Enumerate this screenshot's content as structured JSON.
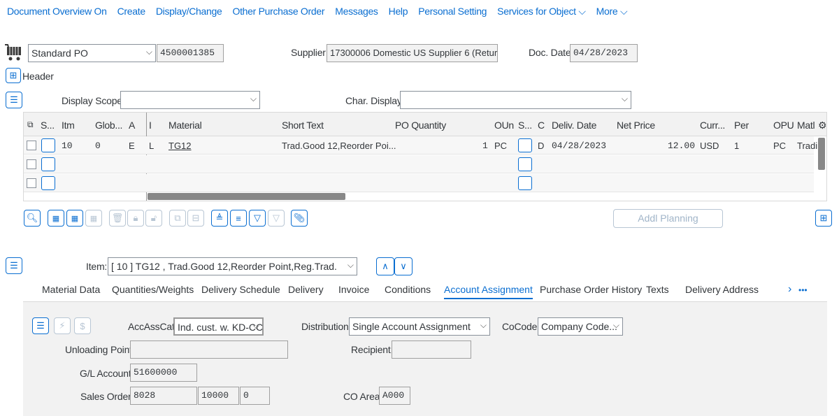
{
  "menu": [
    "Document Overview On",
    "Create",
    "Display/Change",
    "Other Purchase Order",
    "Messages",
    "Help",
    "Personal Setting",
    "Services for Object",
    "More"
  ],
  "doc": {
    "type": "Standard PO",
    "number": "4500001385",
    "supplier_label": "Supplier:",
    "supplier": "17300006 Domestic US Supplier 6 (Retur...",
    "date_label": "Doc. Date:",
    "date": "04/28/2023",
    "header_label": "Header"
  },
  "scope": {
    "display_scope_label": "Display Scope:",
    "display_scope": "",
    "char_display_label": "Char. Display:",
    "char_display": ""
  },
  "grid": {
    "headers": [
      "S...",
      "Itm",
      "Glob...",
      "A",
      "I",
      "Material",
      "Short Text",
      "PO Quantity",
      "OUn",
      "S...",
      "C",
      "Deliv. Date",
      "Net Price",
      "Curr...",
      "Per",
      "OPU",
      "Matl"
    ],
    "rows": [
      {
        "itm": "10",
        "glob": "0",
        "a": "E",
        "i": "L",
        "material": "TG12",
        "short_text": "Trad.Good 12,Reorder Poi...",
        "qty": "1",
        "oun": "PC",
        "c": "D",
        "date": "04/28/2023",
        "price": "12.00",
        "curr": "USD",
        "per": "1",
        "opu": "PC",
        "matl": "Tradii"
      }
    ]
  },
  "toolbar": {
    "addl_planning": "Addl Planning"
  },
  "item": {
    "label": "Item:",
    "value": "[ 10 ] TG12 , Trad.Good 12,Reorder Point,Reg.Trad."
  },
  "tabs": [
    "Material Data",
    "Quantities/Weights",
    "Delivery Schedule",
    "Delivery",
    "Invoice",
    "Conditions",
    "Account Assignment",
    "Purchase Order History",
    "Texts",
    "Delivery Address"
  ],
  "acct": {
    "accasscat_label": "AccAssCat:",
    "accasscat": "Ind. cust. w. KD-CC",
    "distribution_label": "Distribution:",
    "distribution": "Single Account Assignment",
    "cocode_label": "CoCode:",
    "cocode": "Company Code...",
    "unloading_label": "Unloading Point:",
    "unloading": "",
    "recipient_label": "Recipient:",
    "recipient": "",
    "gl_label": "G/L Account:",
    "gl": "51600000",
    "sales_order_label": "Sales Order:",
    "sales_order": "8028",
    "sales_item": "10000",
    "sales_sched": "0",
    "coarea_label": "CO Area:",
    "coarea": "A000"
  }
}
